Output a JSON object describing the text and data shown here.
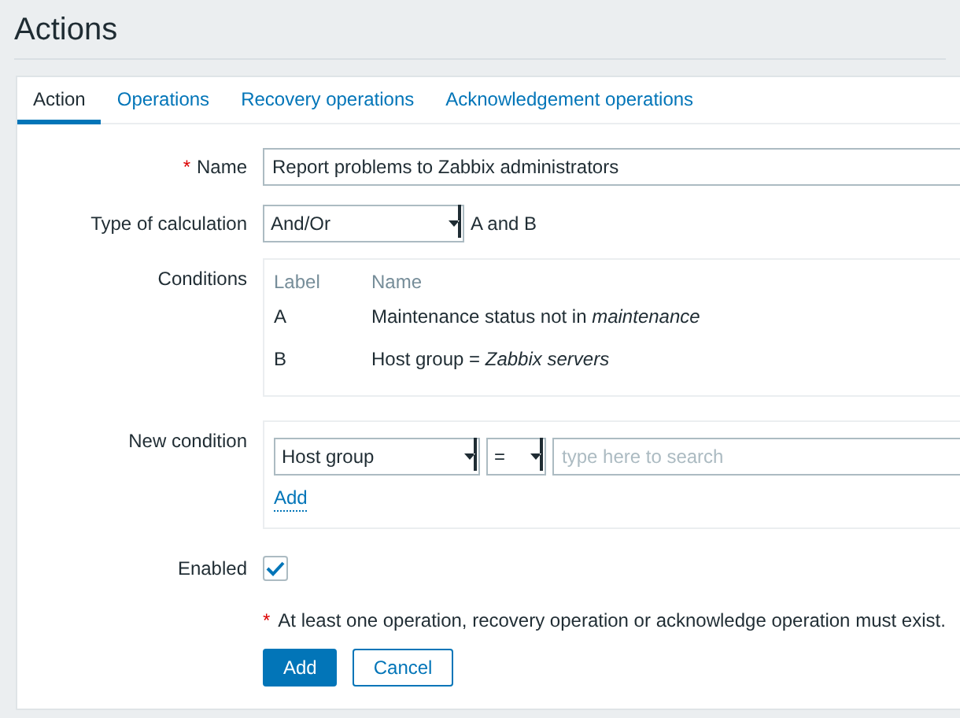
{
  "page": {
    "title": "Actions"
  },
  "tabs": [
    {
      "label": "Action",
      "selected": true
    },
    {
      "label": "Operations",
      "selected": false
    },
    {
      "label": "Recovery operations",
      "selected": false
    },
    {
      "label": "Acknowledgement operations",
      "selected": false
    }
  ],
  "form": {
    "name": {
      "label": "Name",
      "required_mark": "*",
      "value": "Report problems to Zabbix administrators"
    },
    "calculation": {
      "label": "Type of calculation",
      "value": "And/Or",
      "formula": "A and B"
    },
    "conditions": {
      "label": "Conditions",
      "columns": [
        "Label",
        "Name"
      ],
      "rows": [
        {
          "label": "A",
          "name": "Maintenance status not in *maintenance*"
        },
        {
          "label": "B",
          "name": "Host group = *Zabbix servers*"
        }
      ]
    },
    "new_condition": {
      "label": "New condition",
      "type": "Host group",
      "operator": "=",
      "placeholder": "type here to search",
      "add_link": "Add"
    },
    "enabled": {
      "label": "Enabled",
      "checked": true
    },
    "note": {
      "mark": "*",
      "text": "At least one operation, recovery operation or acknowledge operation must exist."
    },
    "buttons": [
      {
        "label": "Add",
        "kind": "primary"
      },
      {
        "label": "Cancel",
        "kind": "secondary"
      }
    ]
  }
}
